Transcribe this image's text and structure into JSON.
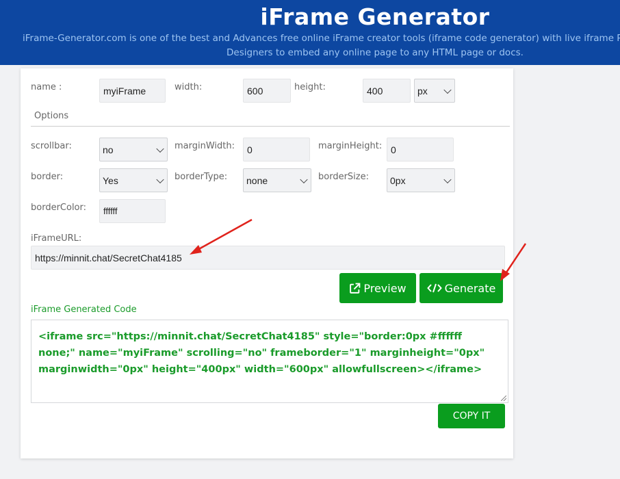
{
  "header": {
    "title": "iFrame Generator",
    "subtitle_line1": "iFrame-Generator.com is one of the best and Advances free online iFrame creator tools (iframe code generator) with live iframe Preview option for",
    "subtitle_line2": "Designers to embed any online page to any HTML page or docs."
  },
  "form": {
    "name_label": "name :",
    "name_value": "myiFrame",
    "width_label": "width:",
    "width_value": "600",
    "height_label": "height:",
    "height_value": "400",
    "unit_value": "px",
    "options_label": "Options",
    "scrollbar_label": "scrollbar:",
    "scrollbar_value": "no",
    "margin_width_label": "marginWidth:",
    "margin_width_value": "0",
    "margin_height_label": "marginHeight:",
    "margin_height_value": "0",
    "border_label": "border:",
    "border_value": "Yes",
    "border_type_label": "borderType:",
    "border_type_value": "none",
    "border_size_label": "borderSize:",
    "border_size_value": "0px",
    "border_color_label": "borderColor:",
    "border_color_value": "ffffff",
    "url_label": "iFrameURL:",
    "url_value": "https://minnit.chat/SecretChat4185"
  },
  "buttons": {
    "preview": "Preview",
    "generate": "Generate",
    "copy": "COPY IT"
  },
  "output": {
    "label": "iFrame Generated Code",
    "code": "<iframe src=\"https://minnit.chat/SecretChat4185\" style=\"border:0px #ffffff none;\" name=\"myiFrame\" scrolling=\"no\" frameborder=\"1\" marginheight=\"0px\" marginwidth=\"0px\" height=\"400px\" width=\"600px\" allowfullscreen></iframe>"
  },
  "colors": {
    "header_bg": "#0d47a1",
    "button_green": "#0a9d1e",
    "annotation_red": "#e0231c"
  }
}
